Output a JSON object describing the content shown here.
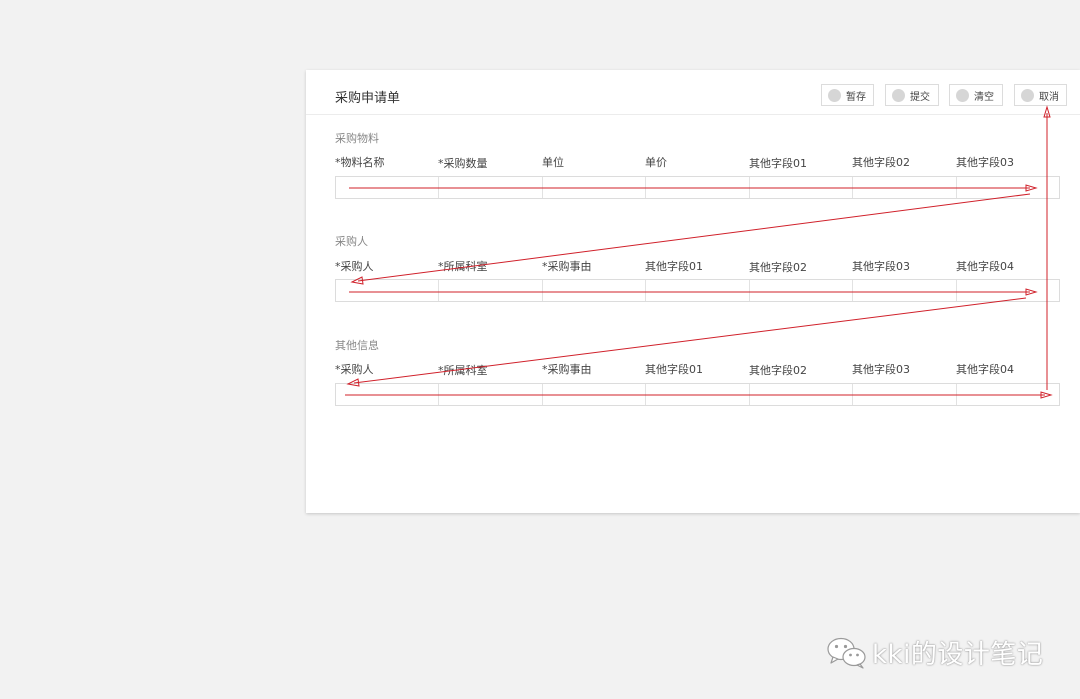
{
  "form": {
    "title": "采购申请单"
  },
  "toolbar": {
    "buttons": [
      {
        "label": "暂存",
        "icon": "circle-icon"
      },
      {
        "label": "提交",
        "icon": "circle-icon"
      },
      {
        "label": "清空",
        "icon": "circle-icon"
      },
      {
        "label": "取消",
        "icon": "circle-icon"
      }
    ]
  },
  "sections": [
    {
      "title": "采购物料",
      "columns": [
        "*物料名称",
        "*采购数量",
        "单位",
        "单价",
        "其他字段01",
        "其他字段02",
        "其他字段03"
      ]
    },
    {
      "title": "采购人",
      "columns": [
        "*采购人",
        "*所属科室",
        "*采购事由",
        "其他字段01",
        "其他字段02",
        "其他字段03",
        "其他字段04"
      ]
    },
    {
      "title": "其他信息",
      "columns": [
        "*采购人",
        "*所属科室",
        "*采购事由",
        "其他字段01",
        "其他字段02",
        "其他字段03",
        "其他字段04"
      ]
    }
  ],
  "annotation": {
    "arrow_color": "#d0202a"
  },
  "watermark": {
    "text": "kki的设计笔记",
    "icon": "wechat-icon"
  }
}
